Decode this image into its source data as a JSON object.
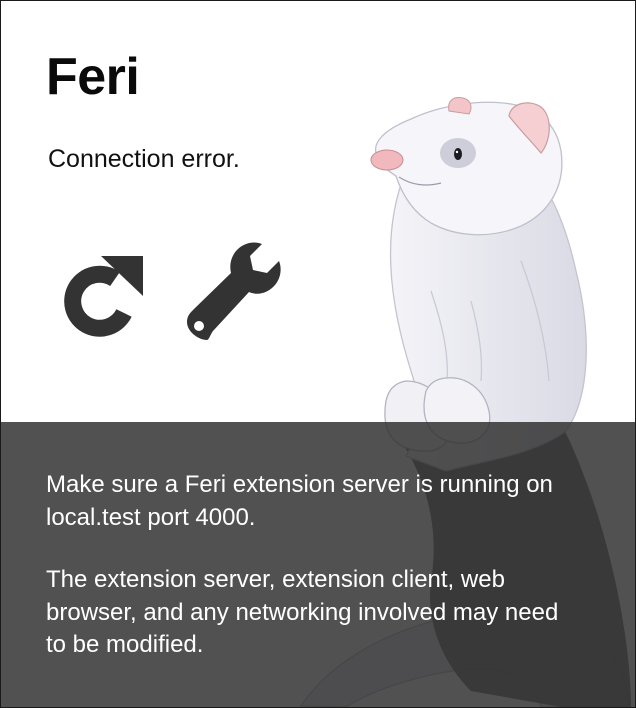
{
  "app": {
    "title": "Feri"
  },
  "status": {
    "message": "Connection error."
  },
  "actions": {
    "reload_icon": "reload-icon",
    "settings_icon": "wrench-icon"
  },
  "help": {
    "hint": "Make sure a Feri extension server is running on local.test port 4000.",
    "detail": "The extension server, extension client, web browser, and any networking involved may need to be modified."
  },
  "colors": {
    "icon": "#333333",
    "overlay": "#303030",
    "text_light": "#ffffff",
    "title": "#0a0a0a"
  },
  "illustration": {
    "subject": "ferret-mascot"
  }
}
